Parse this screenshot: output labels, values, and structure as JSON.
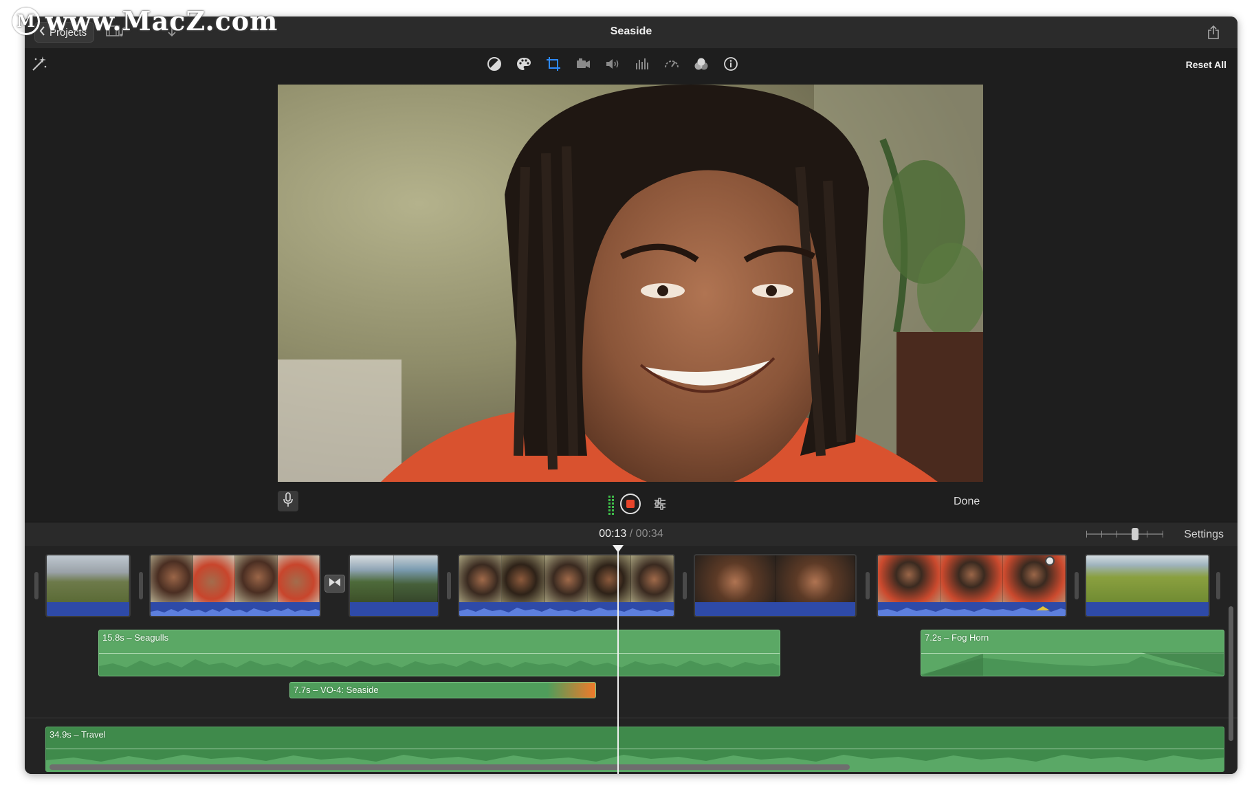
{
  "watermark": {
    "text": "www.MacZ.com",
    "logo_letter": "M"
  },
  "titlebar": {
    "back_label": "Projects",
    "title": "Seaside"
  },
  "toolbar": {
    "reset_label": "Reset All",
    "tools": [
      "color-balance-icon",
      "color-correction-icon",
      "crop-icon",
      "stabilization-icon",
      "volume-icon",
      "noise-reduction-equalizer-icon",
      "speed-icon",
      "clip-filter-icon",
      "info-icon"
    ],
    "active_tool": "crop-icon"
  },
  "voiceover": {
    "done_label": "Done"
  },
  "timeline_header": {
    "current_time": "00:13",
    "separator": "/",
    "total_time": "00:34",
    "settings_label": "Settings"
  },
  "audio_clips": {
    "seagulls": "15.8s – Seagulls",
    "voiceover": "7.7s – VO-4: Seaside",
    "fog_horn": "7.2s – Fog Horn",
    "travel": "34.9s – Travel"
  },
  "colors": {
    "accent": "#2e8bff",
    "record": "#e8442a",
    "audio_clip_green": "#5ba865",
    "clip_audio_blue": "#2e4aa8",
    "voiceover_fade_orange": "#f07a2a"
  }
}
